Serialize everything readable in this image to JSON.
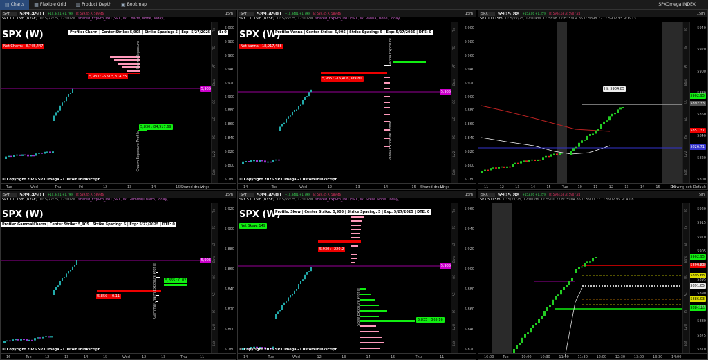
{
  "topbar": {
    "tabs": [
      "Charts",
      "Flexible Grid",
      "Product Depth",
      "Bookmap"
    ],
    "right_title": "SPXOmega INDEX"
  },
  "panels": {
    "p1": {
      "symbol": "SPY",
      "price": "589.4501",
      "chg": "+10.3401 +1.79%",
      "ba": "B: 589.45 A: 589.46",
      "tf": "15m",
      "desc": "SPY 1 D 15m [NYSE]",
      "date": "D: 5/27/25, 12:00PM",
      "study": "shared_ExpPro_IND (SPX, W, Charm, None, Today,...",
      "big": "SPX (W)",
      "profile": "Profile: Charm | Center Strike: 5,905 | Strike Spacing: 5 | Exp: 5/27/2025 | DTE: 0",
      "net": "Net Charm: -8,745,447",
      "tag1": "5,930 : -5,905,314.35",
      "tag2": "5,830 : 84,917.69",
      "price_tag": "5,905.33",
      "vlabel": "Charm Exposure Profile",
      "vlabel2": "Charm Exposure",
      "x": [
        "Tue",
        "Wed",
        "Thu",
        "Fri",
        "12",
        "13",
        "14",
        "15",
        "16"
      ],
      "y": [
        "6,000",
        "5,980",
        "5,960",
        "5,940",
        "5,920",
        "5,900",
        "5,880",
        "5,860",
        "5,840",
        "5,820",
        "5,800",
        "5,780"
      ]
    },
    "p2": {
      "symbol": "SPY",
      "price": "589.4501",
      "chg": "+10.3401 +1.79%",
      "ba": "B: 589.45 A: 589.46",
      "tf": "15m",
      "desc": "SPY 1 D 15m [NYSE]",
      "date": "D: 5/27/25, 12:00PM",
      "study": "shared_ExpPro_IND (SPX, W, Vanna, None, Today,...",
      "big": "SPX (W)",
      "profile": "Profile: Vanna | Center Strike: 5,905 | Strike Spacing: 5 | Exp: 5/27/2025 | DTE: 0",
      "net": "Net Vanna: -18,917,488",
      "tag1": "5,935 : -16,406,389.80",
      "price_tag": "5,905.69",
      "vlabel": "Vanna Exposure Profile",
      "vlabel2": "Vanna Exposure",
      "x": [
        "14",
        "Tue",
        "Wed",
        "12",
        "13",
        "14",
        "15",
        "16"
      ],
      "y": [
        "6,000",
        "5,980",
        "5,960",
        "5,940",
        "5,920",
        "5,900",
        "5,880",
        "5,860",
        "5,840",
        "5,820",
        "5,800",
        "5,780"
      ]
    },
    "p3": {
      "symbol": "SPX",
      "price": "5905.88",
      "chg": "+153.06 +1.35%",
      "ba": "B: 5904.63 A: 5907.24",
      "tf": "15m",
      "desc": "SPX 1 D 15m",
      "date": "D: 5/27/25, 12:00PM",
      "ohlc": "O: 5898.72 H: 5904.85 L: 5898.72 C: 5902.95 R: 6.13",
      "hi": "Hi: 5904.85",
      "tags": [
        "5902.95",
        "5892.33",
        "5851.37",
        "5826.71"
      ],
      "x": [
        "11",
        "12",
        "13",
        "14",
        "15",
        "Tue",
        "10",
        "11",
        "12",
        "13",
        "14",
        "15",
        "16"
      ],
      "y": [
        "5940",
        "5920",
        "5900",
        "5880",
        "5860",
        "5840",
        "5820",
        "5800"
      ],
      "drawing": "Drawing set: Default"
    },
    "p4": {
      "symbol": "SPY",
      "price": "589.4501",
      "chg": "+10.3401 +1.79%",
      "ba": "B: 589.45 A: 589.46",
      "tf": "15m",
      "desc": "SPY 1 D 15m [NYSE]",
      "date": "D: 5/27/25, 12:00PM",
      "study": "shared_ExpPro_IND (SPX, W, Gamma/Charm, Today,...",
      "big": "SPX (W)",
      "profile": "Profile: Gamma/Charm | Center Strike: 5,905 | Strike Spacing: 5 | Exp: 5/27/2025 | DTE: 0",
      "tag1": "5,865 : 0.02",
      "tag2": "5,856 : -0.11",
      "price_tag": "5,905.66",
      "vlabel": "Gamma/Charm Exposure Profile",
      "x": [
        "16",
        "Tue",
        "12",
        "13",
        "14",
        "15",
        "Wed",
        "12",
        "13",
        "Thu",
        "11"
      ],
      "y": [
        "5,920",
        "5,900",
        "5,880",
        "5,860",
        "5,840",
        "5,820",
        "5,800",
        "5,780"
      ]
    },
    "p5": {
      "symbol": "SPY",
      "price": "589.4501",
      "chg": "+10.3401 +1.79%",
      "ba": "B: 589.45 A: 589.46",
      "tf": "15m",
      "desc": "SPY 5 D 15m [NYSE]",
      "date": "D: 5/27/25, 12:00PM",
      "study": "shared_ExpPro_IND (SPX, W, Skew, None, Today,...",
      "big": "SPX (W)",
      "profile": "Profile: Skew | Center Strike: 5,905 | Strike Spacing: 5 | Exp: 5/27/2025 | DTE: 0",
      "net": "Net Skew: 149",
      "tag1": "5,930 : -220.2",
      "tag2": "5,835 : 365.16",
      "price_tag": "5,905.53",
      "vlabel": "Skew Exposure Profile",
      "x": [
        "14",
        "Tue",
        "Wed",
        "12",
        "13",
        "14",
        "15",
        "Thu",
        "11"
      ],
      "y": [
        "5,960",
        "5,940",
        "5,920",
        "5,900",
        "5,880",
        "5,860",
        "5,840",
        "5,820"
      ]
    },
    "p6": {
      "symbol": "SPX",
      "price": "5905.88",
      "chg": "+153.06 +1.35%",
      "ba": "B: 5904.63 A: 5907.24",
      "tf": "5m",
      "desc": "SPX 5 D 5m",
      "date": "D: 5/27/25, 12:00PM",
      "ohlc": "O: 5900.77 H: 5904.85 L: 5900.77 C: 5902.95 R: 4.08",
      "tags": [
        "5902.95",
        "5899.82",
        "5895.68",
        "5891.05",
        "5886.03",
        "5884.16"
      ],
      "x": [
        "16:00",
        "Tue",
        "10:00",
        "10:30",
        "11:00",
        "11:30",
        "12:00",
        "12:30",
        "13:00",
        "13:30",
        "14:00"
      ],
      "y": [
        "5920",
        "5915",
        "5910",
        "5905",
        "5900",
        "5895",
        "5890",
        "5885",
        "5880",
        "5875",
        "5870"
      ]
    },
    "shared": "Shared drawings",
    "copyright": "© Copyright 2025 SPXOmega - CustomThinkscript",
    "sidetabs": [
      "Trd",
      "TS",
      "AT",
      "Btns",
      "OC",
      "AC",
      "PS",
      "Lvl2",
      "Edit"
    ]
  },
  "colors": {
    "red": "#ee0000",
    "green": "#11ee11",
    "magenta": "#cc00cc",
    "candle_up": "#22aaaa",
    "candle_down": "#9933cc"
  }
}
